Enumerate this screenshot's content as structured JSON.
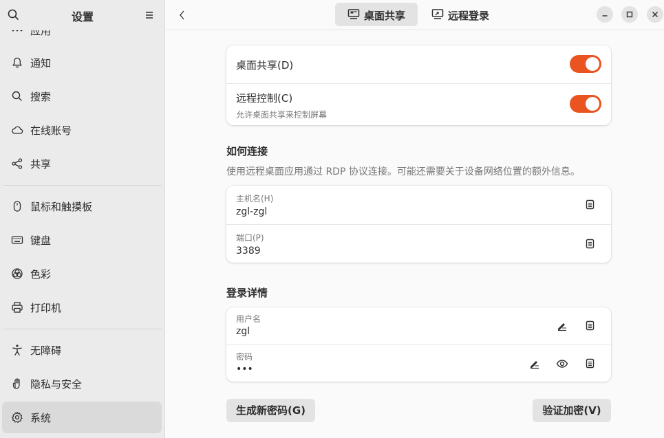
{
  "sidebar": {
    "title": "设置",
    "items": [
      {
        "label": "应用",
        "icon": "apps-icon"
      },
      {
        "label": "通知",
        "icon": "bell-icon"
      },
      {
        "label": "搜索",
        "icon": "search-icon"
      },
      {
        "label": "在线账号",
        "icon": "cloud-icon"
      },
      {
        "label": "共享",
        "icon": "share-icon"
      },
      {
        "label": "鼠标和触摸板",
        "icon": "mouse-icon"
      },
      {
        "label": "键盘",
        "icon": "keyboard-icon"
      },
      {
        "label": "色彩",
        "icon": "color-icon"
      },
      {
        "label": "打印机",
        "icon": "printer-icon"
      },
      {
        "label": "无障碍",
        "icon": "accessibility-icon"
      },
      {
        "label": "隐私与安全",
        "icon": "privacy-icon"
      },
      {
        "label": "系统",
        "icon": "system-icon"
      }
    ]
  },
  "header": {
    "tabs": [
      {
        "label": "桌面共享",
        "icon": "desktop-share-icon"
      },
      {
        "label": "远程登录",
        "icon": "remote-login-icon"
      }
    ]
  },
  "sharing": {
    "desktop_sharing": "桌面共享(D)",
    "remote_control": "远程控制(C)",
    "remote_control_sub": "允许桌面共享来控制屏幕"
  },
  "connect": {
    "title": "如何连接",
    "desc": "使用远程桌面应用通过 RDP 协议连接。可能还需要关于设备网络位置的额外信息。",
    "hostname_label": "主机名(H)",
    "hostname_value": "zgl-zgl",
    "port_label": "端口(P)",
    "port_value": "3389"
  },
  "login": {
    "title": "登录详情",
    "username_label": "用户名",
    "username_value": "zgl",
    "password_label": "密码",
    "password_value": "•••"
  },
  "actions": {
    "generate": "生成新密码(G)",
    "verify": "验证加密(V)"
  },
  "colors": {
    "accent": "#e95420"
  }
}
